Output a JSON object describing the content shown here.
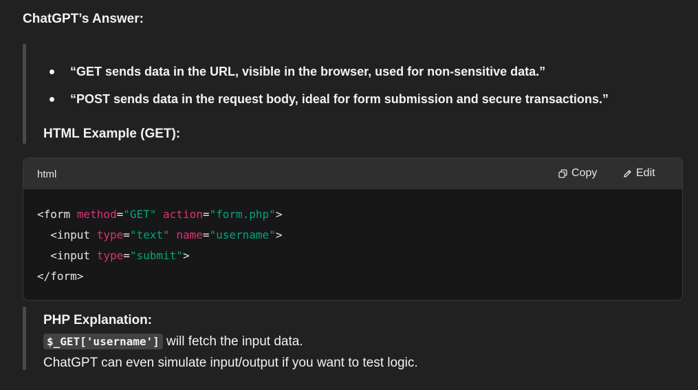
{
  "heading": "ChatGPT’s Answer:",
  "bullets": [
    "“GET sends data in the URL, visible in the browser, used for non-sensitive data.”",
    "“POST sends data in the request body, ideal for form submission and secure transactions.”"
  ],
  "subheading": "HTML Example (GET):",
  "code": {
    "language": "html",
    "copy_label": "Copy",
    "edit_label": "Edit",
    "lines": [
      [
        {
          "t": "tag",
          "v": "<form "
        },
        {
          "t": "attr",
          "v": "method"
        },
        {
          "t": "tag",
          "v": "="
        },
        {
          "t": "str",
          "v": "\"GET\""
        },
        {
          "t": "tag",
          "v": " "
        },
        {
          "t": "attr",
          "v": "action"
        },
        {
          "t": "tag",
          "v": "="
        },
        {
          "t": "str",
          "v": "\"form.php\""
        },
        {
          "t": "tag",
          "v": ">"
        }
      ],
      [
        {
          "t": "tag",
          "v": "  <input "
        },
        {
          "t": "attr",
          "v": "type"
        },
        {
          "t": "tag",
          "v": "="
        },
        {
          "t": "str",
          "v": "\"text\""
        },
        {
          "t": "tag",
          "v": " "
        },
        {
          "t": "attr",
          "v": "name"
        },
        {
          "t": "tag",
          "v": "="
        },
        {
          "t": "str",
          "v": "\"username\""
        },
        {
          "t": "tag",
          "v": ">"
        }
      ],
      [
        {
          "t": "tag",
          "v": "  <input "
        },
        {
          "t": "attr",
          "v": "type"
        },
        {
          "t": "tag",
          "v": "="
        },
        {
          "t": "str",
          "v": "\"submit\""
        },
        {
          "t": "tag",
          "v": ">"
        }
      ],
      [
        {
          "t": "tag",
          "v": "</form>"
        }
      ]
    ]
  },
  "php": {
    "title": "PHP Explanation:",
    "inline_code": "$_GET['username']",
    "line2_rest": " will fetch the input data.",
    "line3": "ChatGPT can even simulate input/output if you want to test logic."
  },
  "colors": {
    "background": "#212121",
    "code_background": "#171717",
    "code_header": "#2f2f2f",
    "attribute": "#df3079",
    "string": "#00a67d"
  },
  "icons": {
    "copy": "copy-icon",
    "edit": "pencil-icon"
  }
}
